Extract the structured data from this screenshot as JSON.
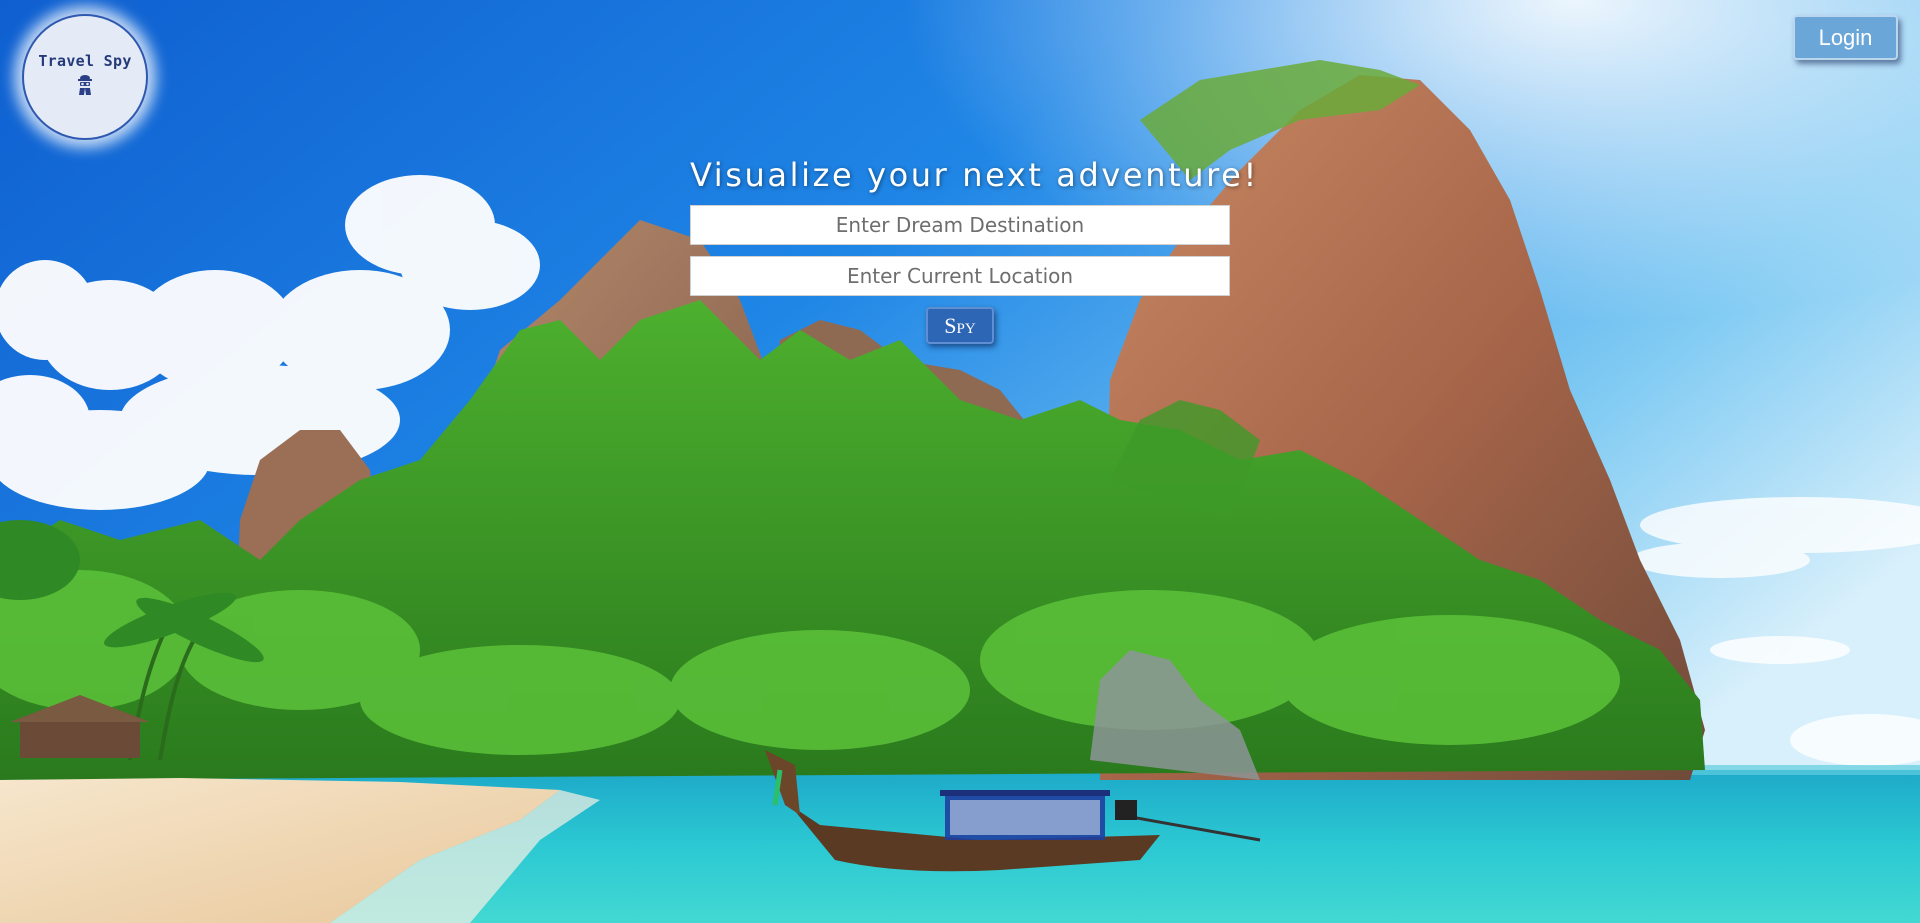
{
  "logo": {
    "text": "Travel Spy",
    "icon": "spy-icon"
  },
  "header": {
    "login_label": "Login"
  },
  "search": {
    "headline": "Visualize your next adventure!",
    "destination_placeholder": "Enter Dream Destination",
    "destination_value": "",
    "location_placeholder": "Enter Current Location",
    "location_value": "",
    "submit_label": "Spy"
  },
  "background": {
    "description_icon": "tropical-beach-photo",
    "sky_color": "#1f7fe0",
    "water_color": "#25c7d1",
    "sand_color": "#f1d9b4",
    "accent_color": "#2c66b5"
  }
}
